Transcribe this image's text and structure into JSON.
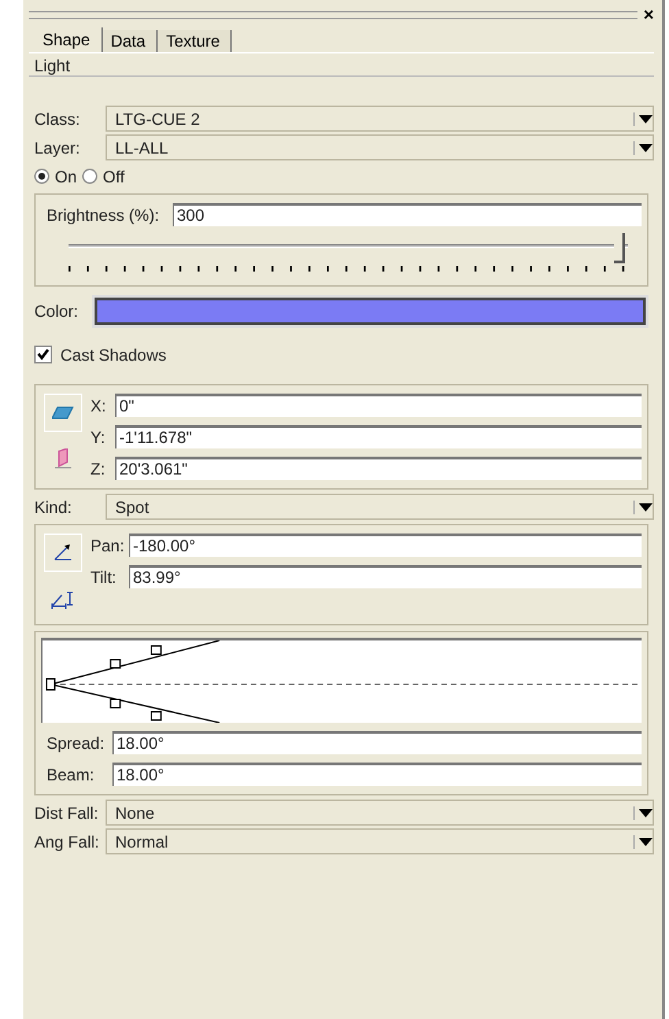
{
  "window": {
    "close": "×"
  },
  "tabs": [
    {
      "label": "Shape",
      "selected": true
    },
    {
      "label": "Data",
      "selected": false
    },
    {
      "label": "Texture",
      "selected": false
    }
  ],
  "object_type": "Light",
  "top_dropdowns": [
    {
      "label": "Class:",
      "value": "LTG-CUE 2"
    },
    {
      "label": "Layer:",
      "value": "LL-ALL"
    }
  ],
  "power": [
    {
      "label": "On",
      "selected": true
    },
    {
      "label": "Off",
      "selected": false
    }
  ],
  "brightness": {
    "label": "Brightness (%):",
    "value": "300",
    "level": 0.99
  },
  "color": {
    "label": "Color:",
    "color": "#7b7bf4"
  },
  "cast_shadows": {
    "label": "Cast Shadows",
    "checked": true
  },
  "position": [
    {
      "label": "X:",
      "value": "0\""
    },
    {
      "label": "Y:",
      "value": "-1'11.678\""
    },
    {
      "label": "Z:",
      "value": "20'3.061\""
    }
  ],
  "kind": {
    "label": "Kind:",
    "value": "Spot"
  },
  "orientation": [
    {
      "label": "Pan:",
      "value": "-180.00°"
    },
    {
      "label": "Tilt:",
      "value": "83.99°"
    }
  ],
  "beam": [
    {
      "label": "Spread:",
      "value": "18.00°"
    },
    {
      "label": "Beam:",
      "value": "18.00°"
    }
  ],
  "falloff": [
    {
      "label": "Dist Fall:",
      "value": "None"
    },
    {
      "label": "Ang Fall:",
      "value": "Normal"
    }
  ]
}
